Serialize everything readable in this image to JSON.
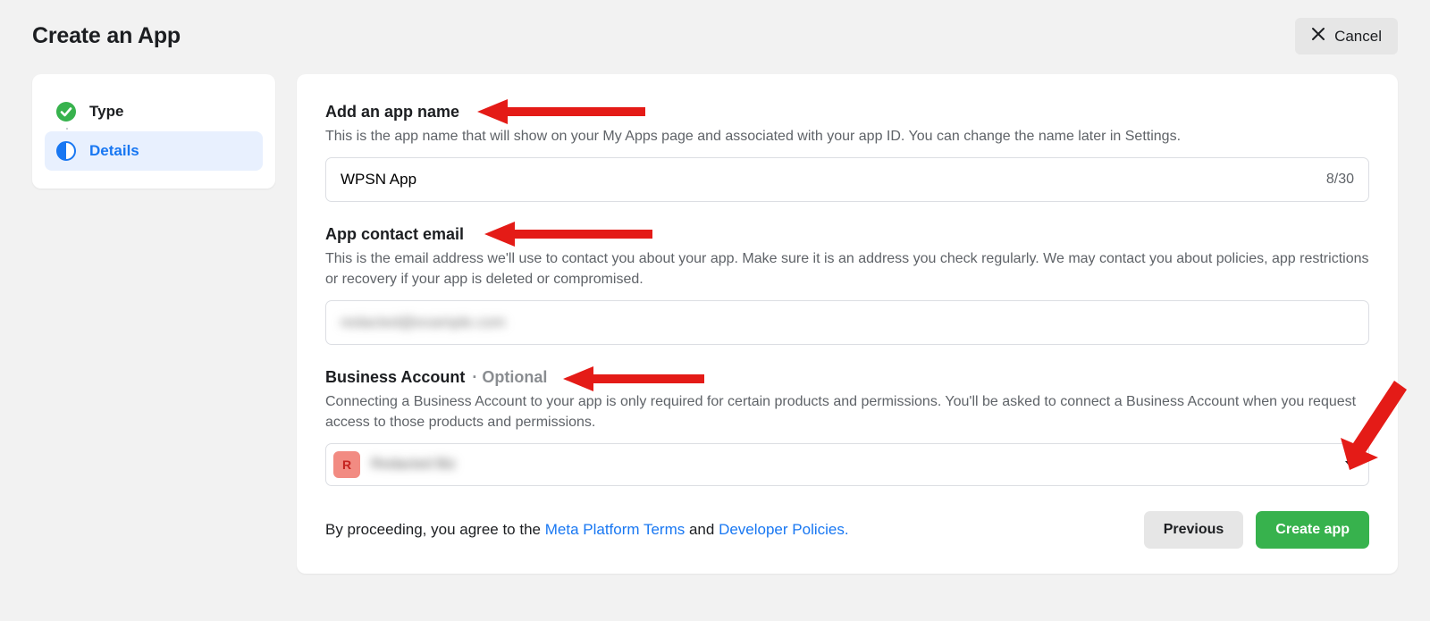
{
  "header": {
    "title": "Create an App",
    "cancel_label": "Cancel"
  },
  "sidebar": {
    "steps": [
      {
        "label": "Type"
      },
      {
        "label": "Details"
      }
    ]
  },
  "form": {
    "app_name": {
      "title": "Add an app name",
      "desc": "This is the app name that will show on your My Apps page and associated with your app ID. You can change the name later in Settings.",
      "value": "WPSN App",
      "char_count": "8/30"
    },
    "contact_email": {
      "title": "App contact email",
      "desc": "This is the email address we'll use to contact you about your app. Make sure it is an address you check regularly. We may contact you about policies, app restrictions or recovery if your app is deleted or compromised.",
      "value": "redacted@example.com"
    },
    "business": {
      "title": "Business Account",
      "optional": "· Optional",
      "desc": "Connecting a Business Account to your app is only required for certain products and permissions. You'll be asked to connect a Business Account when you request access to those products and permissions.",
      "avatar_letter": "R",
      "selected_label": "Redacted Biz"
    }
  },
  "footer": {
    "agree_prefix": "By proceeding, you agree to the ",
    "terms_link": "Meta Platform Terms",
    "agree_mid": " and ",
    "policies_link": "Developer Policies.",
    "previous_label": "Previous",
    "create_label": "Create app"
  }
}
